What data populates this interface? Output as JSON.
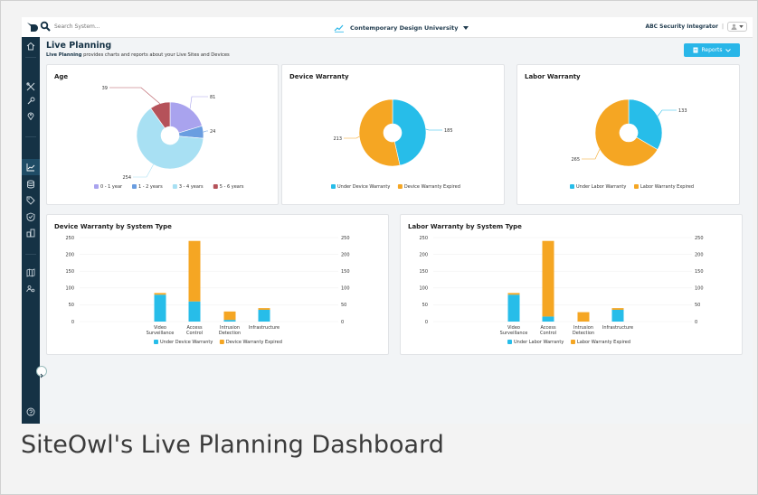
{
  "topbar": {
    "search_placeholder": "Search System...",
    "project_name": "Contemporary Design University",
    "account_name": "ABC Security Integrator",
    "separator": "|"
  },
  "header": {
    "title": "Live Planning",
    "subtitle_bold": "Live Planning",
    "subtitle_rest": " provides charts and reports about your Live Sites and Devices",
    "reports_button": "Reports"
  },
  "sidebar": {
    "icons": [
      "home-icon",
      "tools-icon",
      "wrench-icon",
      "location-pin-icon",
      "chart-icon",
      "database-icon",
      "tag-icon",
      "shield-check-icon",
      "buildings-icon",
      "map-icon",
      "users-cog-icon",
      "help-icon"
    ],
    "active": "chart-icon"
  },
  "colors": {
    "cyan": "#27bde9",
    "orange": "#f5a623",
    "lavender": "#a9a3ee",
    "blue": "#6a9de0",
    "light_blue": "#a8e0f3",
    "maroon": "#b5525a",
    "sidebar": "#153245",
    "accent": "#29b6e8"
  },
  "cards": {
    "age": {
      "title": "Age"
    },
    "device_warranty": {
      "title": "Device Warranty"
    },
    "labor_warranty": {
      "title": "Labor Warranty"
    },
    "device_by_type": {
      "title": "Device Warranty by System Type"
    },
    "labor_by_type": {
      "title": "Labor Warranty by System Type"
    }
  },
  "footer": {
    "caption": "SiteOwl's Live Planning Dashboard"
  },
  "chart_data": [
    {
      "id": "age",
      "type": "pie",
      "title": "Age",
      "categories": [
        "0 - 1 year",
        "1 - 2 years",
        "3 - 4 years",
        "5 - 6 years"
      ],
      "values": [
        81,
        24,
        254,
        39
      ],
      "colors": [
        "#a9a3ee",
        "#6a9de0",
        "#a8e0f3",
        "#b5525a"
      ]
    },
    {
      "id": "device_warranty",
      "type": "pie",
      "title": "Device Warranty",
      "categories": [
        "Under Device Warranty",
        "Device Warranty Expired"
      ],
      "values": [
        185,
        213
      ],
      "colors": [
        "#27bde9",
        "#f5a623"
      ]
    },
    {
      "id": "labor_warranty",
      "type": "pie",
      "title": "Labor Warranty",
      "categories": [
        "Under Labor Warranty",
        "Labor Warranty Expired"
      ],
      "values": [
        133,
        265
      ],
      "colors": [
        "#27bde9",
        "#f5a623"
      ]
    },
    {
      "id": "device_by_type",
      "type": "bar",
      "title": "Device Warranty by System Type",
      "categories": [
        [
          "Video",
          "Surveillance"
        ],
        [
          "Access",
          "Control"
        ],
        [
          "Intrusion",
          "Detection"
        ],
        [
          "Infrastructure"
        ]
      ],
      "series": [
        {
          "name": "Under Device Warranty",
          "values": [
            80,
            60,
            5,
            35
          ],
          "color": "#27bde9"
        },
        {
          "name": "Device Warranty Expired",
          "values": [
            5,
            180,
            25,
            5
          ],
          "color": "#f5a623"
        }
      ],
      "ylim": [
        0,
        250
      ],
      "yticks": [
        0,
        50,
        100,
        150,
        200,
        250
      ]
    },
    {
      "id": "labor_by_type",
      "type": "bar",
      "title": "Labor Warranty by System Type",
      "categories": [
        [
          "Video",
          "Surveillance"
        ],
        [
          "Access",
          "Control"
        ],
        [
          "Intrusion",
          "Detection"
        ],
        [
          "Infrastructure"
        ]
      ],
      "series": [
        {
          "name": "Under Labor Warranty",
          "values": [
            80,
            15,
            0,
            35
          ],
          "color": "#27bde9"
        },
        {
          "name": "Labor Warranty Expired",
          "values": [
            5,
            225,
            28,
            5
          ],
          "color": "#f5a623"
        }
      ],
      "ylim": [
        0,
        250
      ],
      "yticks": [
        0,
        50,
        100,
        150,
        200,
        250
      ]
    }
  ]
}
